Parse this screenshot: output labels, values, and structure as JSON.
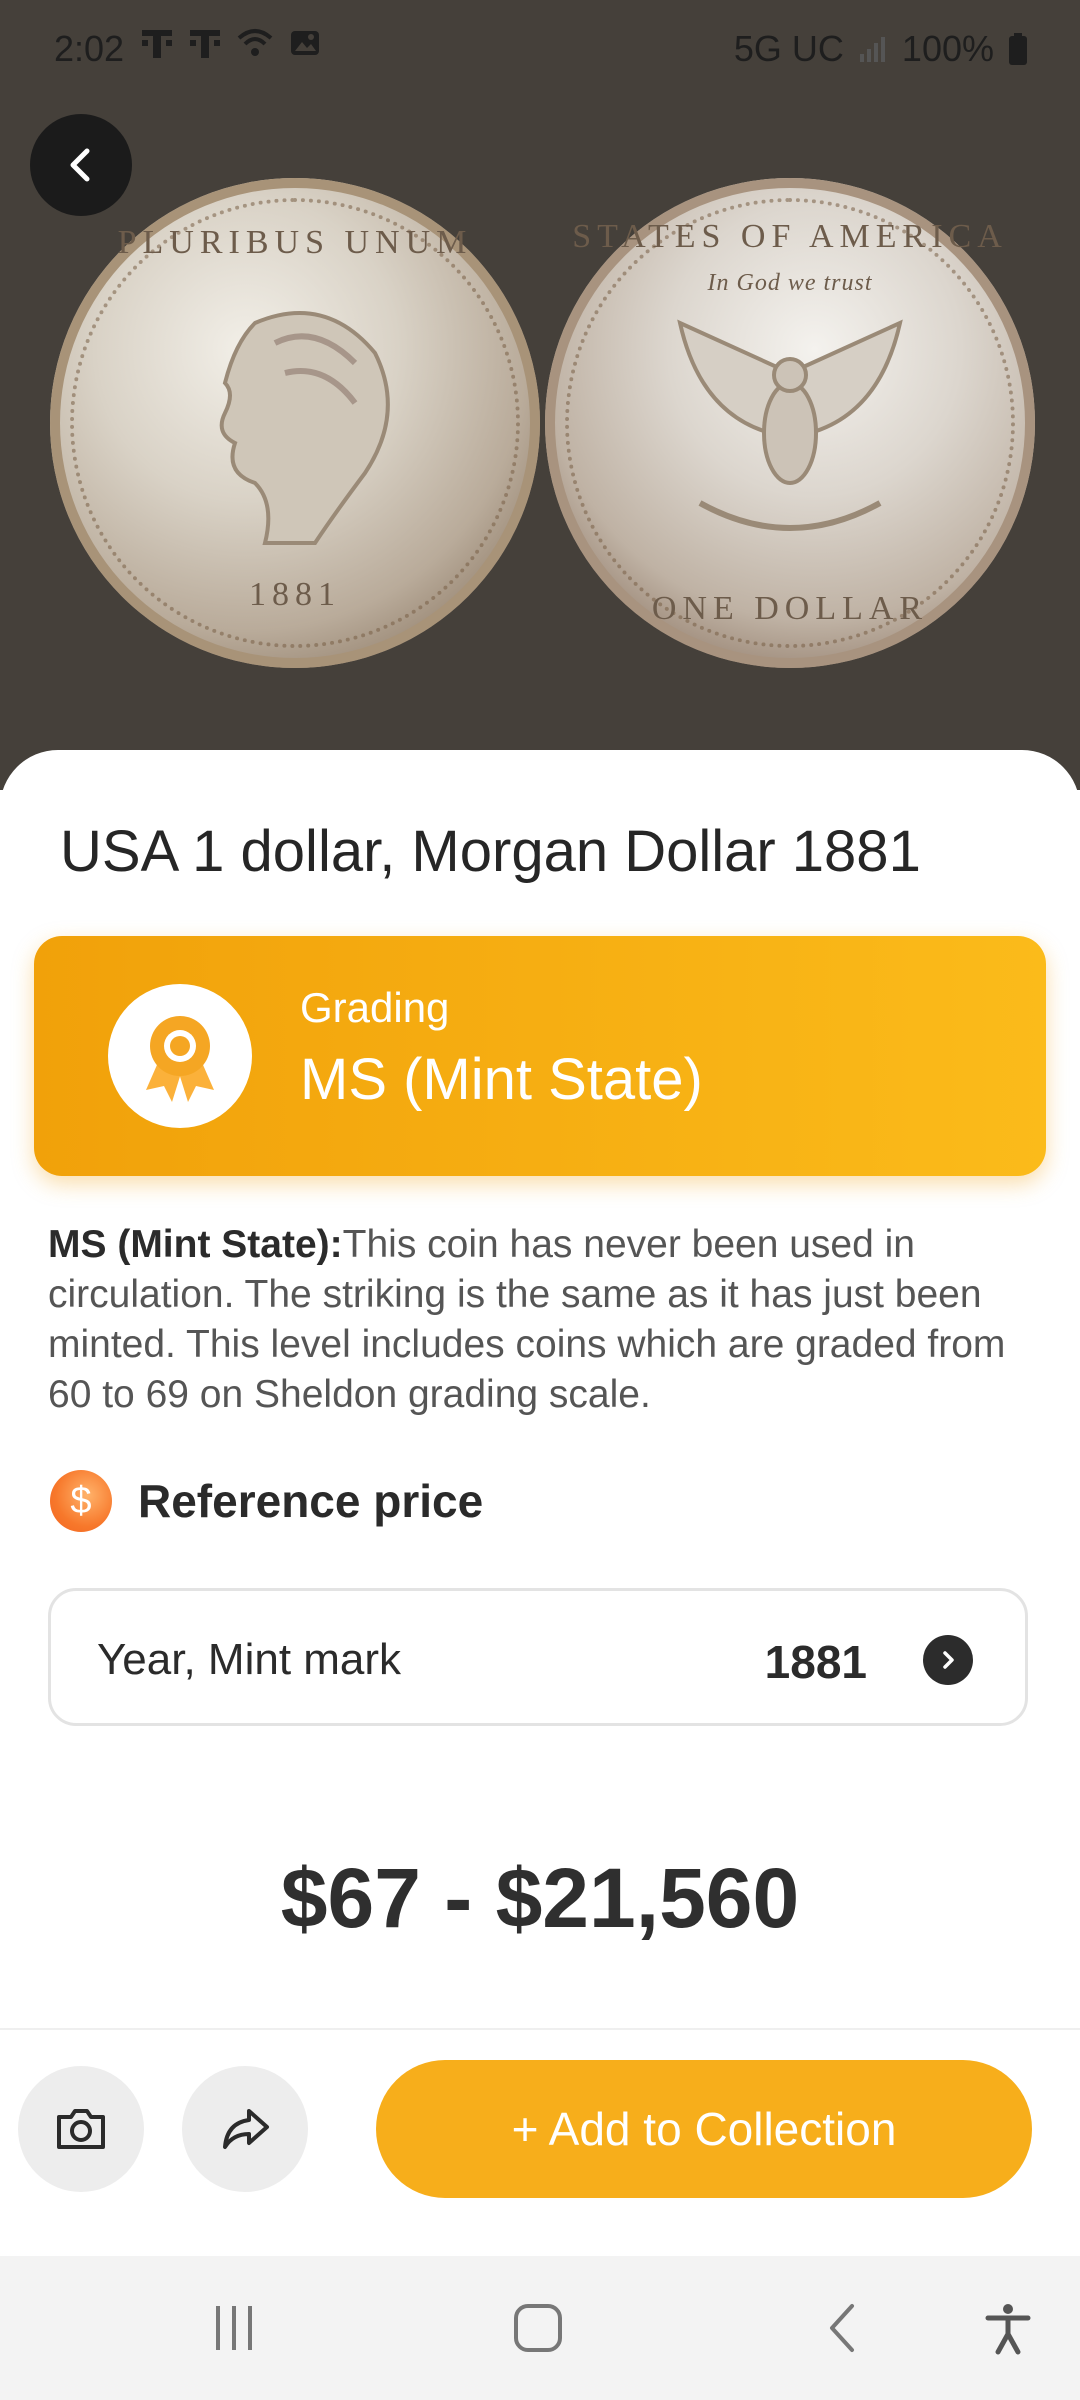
{
  "status_bar": {
    "time": "2:02",
    "network": "5G UC",
    "battery": "100%"
  },
  "hero": {
    "coin_front_text": "PLURIBUS UNUM",
    "coin_front_year": "1881",
    "coin_back_text": "STATES OF AMERICA",
    "coin_back_motto": "In God we trust",
    "coin_back_denomination": "ONE DOLLAR"
  },
  "coin": {
    "title": "USA 1 dollar, Morgan Dollar 1881"
  },
  "grading": {
    "label": "Grading",
    "value": "MS (Mint State)"
  },
  "description": {
    "term": "MS (Mint State):",
    "text": "This coin has never been used in circulation. The striking is the same as it has just been minted. This level includes coins which are graded from 60 to 69 on Sheldon grading scale."
  },
  "reference": {
    "icon": "dollar-icon",
    "title": "Reference price",
    "year_label": "Year, Mint mark",
    "year_value": "1881",
    "price_range": "$67 - $21,560"
  },
  "actions": {
    "add_label": "+ Add to Collection"
  },
  "colors": {
    "accent": "#f7ae1b",
    "grade_card_start": "#f1a10a",
    "grade_card_end": "#fbbb1a",
    "hero_bg": "#45403a"
  }
}
